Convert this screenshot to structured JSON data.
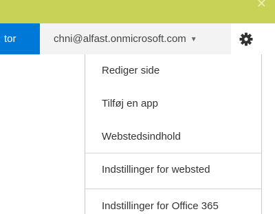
{
  "header": {
    "tab_label": "tor",
    "account_label": "chni@alfast.onmicrosoft.com",
    "dropdown_icon": "chevron-down-icon",
    "settings_icon": "gear-icon",
    "brand_color": "#0078d7",
    "suitebar_color": "#c7d256"
  },
  "menu": {
    "items": [
      {
        "label": "Rediger side"
      },
      {
        "label": "Tilføj en app"
      },
      {
        "label": "Webstedsindhold"
      },
      {
        "label": "Indstillinger for websted"
      },
      {
        "label": "Indstillinger for Office 365"
      }
    ]
  }
}
